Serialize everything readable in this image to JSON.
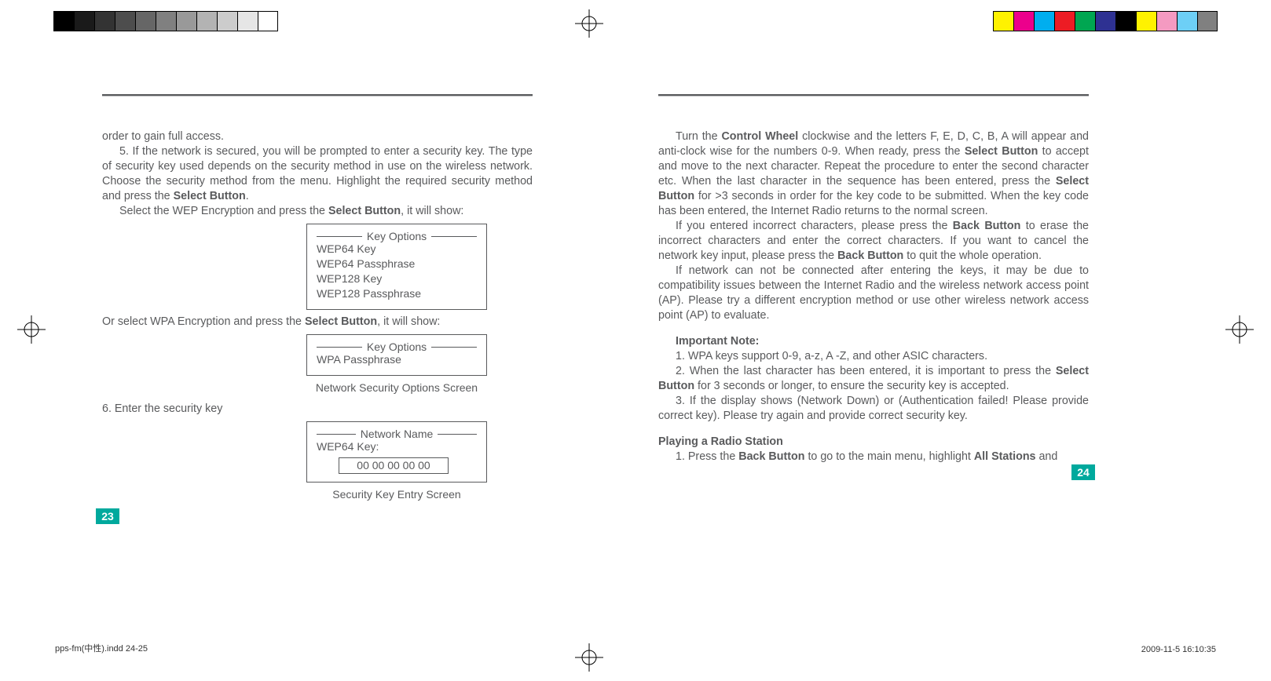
{
  "cal": {
    "left": [
      "#000000",
      "#1a1a1a",
      "#333333",
      "#4d4d4d",
      "#666666",
      "#808080",
      "#999999",
      "#b3b3b3",
      "#cccccc",
      "#e6e6e6",
      "#ffffff"
    ],
    "right": [
      "#fff200",
      "#ec008c",
      "#00aeef",
      "#ed1c24",
      "#00a651",
      "#2e3192",
      "#000000",
      "#fff200",
      "#f49ac1",
      "#6dcff6",
      "#808080"
    ]
  },
  "left": {
    "p1": "order to gain full access.",
    "p2a": "5. If the network is secured, you will be prompted to enter a security key. The type of security key used depends on the security method in use on the wireless network. Choose the security method from the menu. Highlight the required security method and press the ",
    "p2b": "Select Button",
    "p2c": ".",
    "p3a": "Select the WEP Encryption and press the ",
    "p3b": "Select Button",
    "p3c": ", it will show:",
    "box1": {
      "legend": "Key Options",
      "items": [
        "WEP64 Key",
        "WEP64 Passphrase",
        "WEP128 Key",
        "WEP128 Passphrase"
      ]
    },
    "p4a": "Or select WPA Encryption and press the ",
    "p4b": "Select Button",
    "p4c": ", it will show:",
    "box2": {
      "legend": "Key Options",
      "items": [
        "WPA Passphrase"
      ]
    },
    "cap1": "Network Security Options Screen",
    "p5": "6. Enter the security key",
    "box3": {
      "legend": "Network Name",
      "line1": "WEP64 Key:",
      "value": "00 00 00 00 00"
    },
    "cap2": "Security Key Entry Screen",
    "pageno": "23"
  },
  "right": {
    "p1a": "Turn the ",
    "p1b": "Control Wheel",
    "p1c": " clockwise and the letters F, E, D, C, B, A will appear and anti-clock wise for the numbers 0-9. When ready, press the ",
    "p1d": "Select Button",
    "p1e": " to accept and move to the next character. Repeat the procedure to enter the second character etc. When the last character in the sequence has been entered, press the ",
    "p1f": "Select Button",
    "p1g": " for >3 seconds in order for the key code to be submitted. When the key code has been entered, the Internet Radio returns to the normal screen.",
    "p2a": " If you entered incorrect characters, please press the ",
    "p2b": "Back Button",
    "p2c": " to erase the incorrect characters and enter the correct characters. If you want to cancel the network key input, please press the ",
    "p2d": "Back Button",
    "p2e": " to quit the whole operation.",
    "p3": "If network can not be connected after entering the keys, it may be due to compatibility issues between the Internet Radio and the wireless network access point (AP). Please try a different encryption method or use other wireless network access point (AP) to evaluate.",
    "noteHead": "Important Note:",
    "n1": "1. WPA keys support 0-9, a-z, A -Z, and other ASIC characters.",
    "n2a": "2. When the last character has been entered, it is important to press the ",
    "n2b": "Select Button",
    "n2c": " for 3 seconds or longer, to ensure the security key is accepted.",
    "n3": "3. If the display shows (Network Down) or (Authentication failed! Please provide correct key). Please try again and provide correct security key.",
    "playHead": "Playing a Radio Station",
    "pl1a": "1. Press the ",
    "pl1b": "Back Button",
    "pl1c": " to go to the main menu, highlight ",
    "pl1d": "All Stations",
    "pl1e": " and",
    "pageno": "24"
  },
  "imprint": {
    "file": "pps-fm(中性).indd   24-25",
    "date": "2009-11-5   16:10:35"
  }
}
